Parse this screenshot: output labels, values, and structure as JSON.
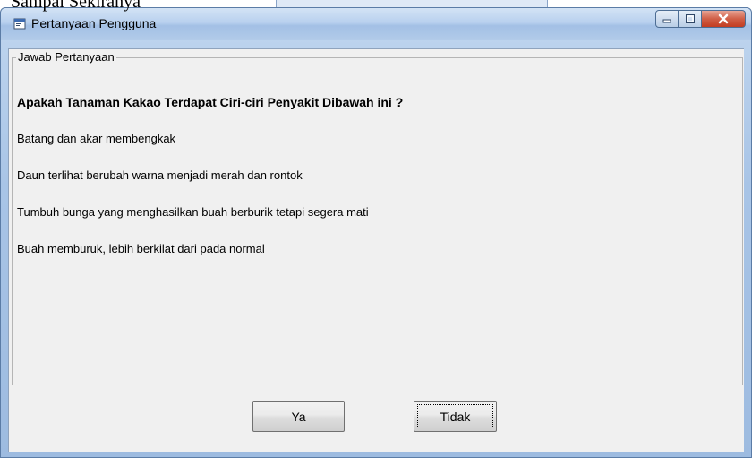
{
  "window": {
    "title": "Pertanyaan Pengguna"
  },
  "background_text": "Sampai Sekiranya",
  "group": {
    "legend": "Jawab Pertanyaan",
    "question": "Apakah Tanaman Kakao Terdapat Ciri-ciri Penyakit Dibawah ini ?",
    "options": [
      "Batang dan akar membengkak",
      "Daun terlihat berubah warna menjadi merah dan rontok",
      "Tumbuh bunga yang menghasilkan buah berburik tetapi segera mati",
      "Buah memburuk, lebih berkilat dari pada normal"
    ]
  },
  "buttons": {
    "yes_label": "Ya",
    "no_label": "Tidak"
  },
  "icons": {
    "app": "app-window-icon",
    "minimize": "minimize-icon",
    "maximize": "maximize-icon",
    "close": "close-icon"
  },
  "colors": {
    "close_button": "#c94a30",
    "client_background": "#f0f0f0",
    "frame": "#a8c4e6"
  }
}
